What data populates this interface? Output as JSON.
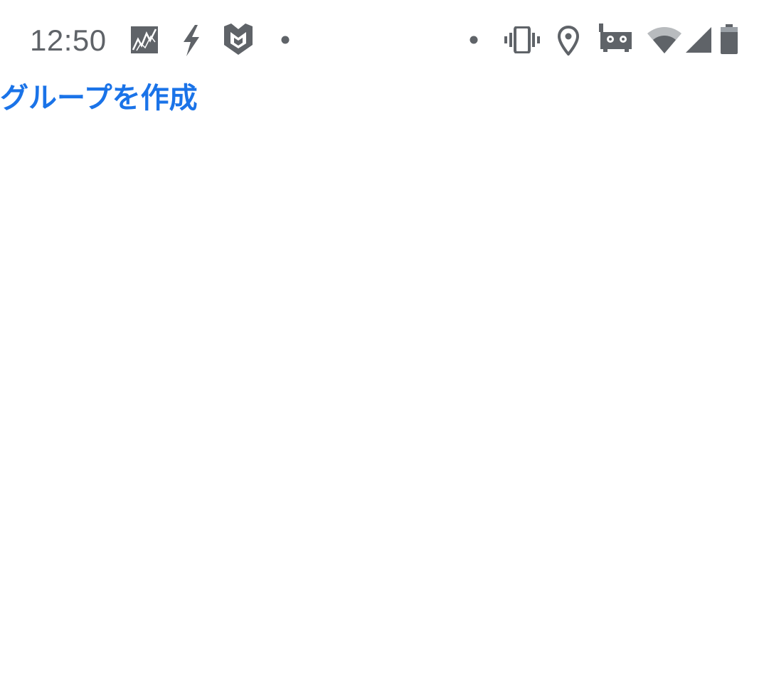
{
  "status_bar": {
    "time": "12:50",
    "notification_icons": [
      "stock-chart-icon",
      "bolt-icon",
      "mcafee-shield-icon",
      "notification-dot-icon"
    ],
    "system_icons": [
      "notification-dot-icon",
      "vibrate-icon",
      "location-pin-icon",
      "vr-headset-icon",
      "wifi-icon",
      "cellular-signal-icon",
      "battery-icon"
    ],
    "icon_color": "#5f6368"
  },
  "main": {
    "create_group_label": "グループを作成",
    "link_color": "#1a73e8"
  }
}
